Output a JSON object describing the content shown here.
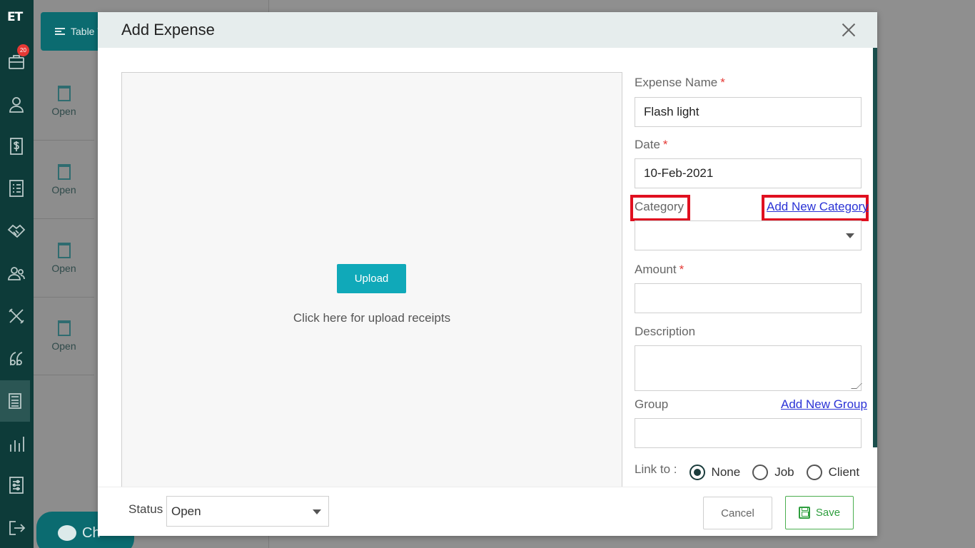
{
  "app": {
    "logo_text": "ET",
    "notification_count": "20"
  },
  "sidebar": {
    "icons": [
      "briefcase-icon",
      "user-icon",
      "dollar-icon",
      "list-icon",
      "handshake-icon",
      "users-icon",
      "tools-icon",
      "quote-icon",
      "calculator-icon",
      "chart-bars-icon",
      "settings-sliders-icon",
      "logout-icon"
    ]
  },
  "background": {
    "table_view_label": "Table V",
    "rows": [
      {
        "status": "Open"
      },
      {
        "status": "Open"
      },
      {
        "status": "Open"
      },
      {
        "status": "Open"
      }
    ],
    "chat_label": "Ch"
  },
  "modal": {
    "title": "Add Expense",
    "upload_button": "Upload",
    "upload_hint": "Click here for upload receipts",
    "fields": {
      "expense_name": {
        "label": "Expense Name",
        "required": "*",
        "value": "Flash light"
      },
      "date": {
        "label": "Date",
        "required": "*",
        "value": "10-Feb-2021"
      },
      "category": {
        "label": "Category",
        "value": "",
        "add_link": "Add New Category"
      },
      "amount": {
        "label": "Amount",
        "required": "*",
        "value": ""
      },
      "description": {
        "label": "Description",
        "value": ""
      },
      "group": {
        "label": "Group",
        "value": "",
        "add_link": "Add New Group"
      }
    },
    "link_to": {
      "label": "Link to :",
      "options": [
        "None",
        "Job",
        "Client"
      ],
      "selected": "None"
    },
    "footer": {
      "status_label": "Status",
      "status_value": "Open",
      "cancel_label": "Cancel",
      "save_label": "Save"
    }
  },
  "colors": {
    "sidebar_bg": "#0d3b39",
    "accent": "#10a9b9",
    "highlight": "#e01020",
    "link": "#2b33d6",
    "save_green": "#2e9e3e"
  }
}
